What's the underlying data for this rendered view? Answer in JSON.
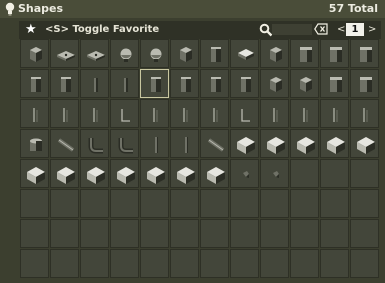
{
  "window": {
    "title": "Shapes",
    "total": "57 Total",
    "title_icon": "lightbulb-icon"
  },
  "toolbar": {
    "favorite_icon": "star-icon",
    "toggle_label": "<S> Toggle Favorite",
    "search_icon": "magnifier-icon",
    "search_value": "",
    "clear_icon": "backspace-icon",
    "page_prev": "<",
    "page_number": "1",
    "page_next": ">"
  },
  "grid": {
    "columns": 12,
    "rows": 8,
    "selected_index": 16,
    "items": [
      {
        "name": "cube-full",
        "kind": "cube"
      },
      {
        "name": "plate-studded",
        "kind": "plate"
      },
      {
        "name": "plate-flat",
        "kind": "plate"
      },
      {
        "name": "sphere-top",
        "kind": "sphere"
      },
      {
        "name": "sphere-pole",
        "kind": "sphere"
      },
      {
        "name": "cube-dark",
        "kind": "cube"
      },
      {
        "name": "pillar-small",
        "kind": "pillar"
      },
      {
        "name": "slab-light",
        "kind": "slab"
      },
      {
        "name": "cube-light",
        "kind": "cube"
      },
      {
        "name": "block-tall",
        "kind": "block"
      },
      {
        "name": "block-tall-dark",
        "kind": "block"
      },
      {
        "name": "block-side",
        "kind": "block"
      },
      {
        "name": "pillar-medium",
        "kind": "pillar"
      },
      {
        "name": "pillar-notched",
        "kind": "pillar"
      },
      {
        "name": "pillar-thin",
        "kind": "pillar-thin"
      },
      {
        "name": "pillar-thin-b",
        "kind": "pillar-thin"
      },
      {
        "name": "pillar-frame",
        "kind": "pillar"
      },
      {
        "name": "pillar-wide",
        "kind": "pillar"
      },
      {
        "name": "pillar-short",
        "kind": "pillar"
      },
      {
        "name": "pillar-stub",
        "kind": "pillar"
      },
      {
        "name": "cube-small",
        "kind": "cube"
      },
      {
        "name": "cube-small-b",
        "kind": "cube"
      },
      {
        "name": "block-bench",
        "kind": "block"
      },
      {
        "name": "block-cabinet",
        "kind": "block"
      },
      {
        "name": "pole-thin",
        "kind": "pole"
      },
      {
        "name": "pole-double",
        "kind": "pole"
      },
      {
        "name": "pole-triple",
        "kind": "pole"
      },
      {
        "name": "pole-bent",
        "kind": "pole-bent"
      },
      {
        "name": "pole-single",
        "kind": "pole"
      },
      {
        "name": "pole-short",
        "kind": "pole"
      },
      {
        "name": "pole-tiny",
        "kind": "pole"
      },
      {
        "name": "pole-corner",
        "kind": "pole-bent"
      },
      {
        "name": "pole-thin-b",
        "kind": "pole"
      },
      {
        "name": "pole-short-b",
        "kind": "pole"
      },
      {
        "name": "pole-stub",
        "kind": "pole"
      },
      {
        "name": "pole-stub-b",
        "kind": "pole"
      },
      {
        "name": "cylinder-cap",
        "kind": "cylinder"
      },
      {
        "name": "pipe-diagonal",
        "kind": "pipe"
      },
      {
        "name": "pipe-elbow",
        "kind": "pipe-elbow"
      },
      {
        "name": "pipe-bend",
        "kind": "pipe-elbow"
      },
      {
        "name": "rod-vertical",
        "kind": "rod"
      },
      {
        "name": "rod-ribbed",
        "kind": "rod"
      },
      {
        "name": "pipe-joint",
        "kind": "pipe"
      },
      {
        "name": "wedge-white",
        "kind": "wedge"
      },
      {
        "name": "wedge-white-b",
        "kind": "wedge"
      },
      {
        "name": "wedge-flat",
        "kind": "wedge"
      },
      {
        "name": "wedge-corner",
        "kind": "wedge"
      },
      {
        "name": "wedge-ramp",
        "kind": "wedge"
      },
      {
        "name": "wedge-cube",
        "kind": "wedge"
      },
      {
        "name": "wedge-slope",
        "kind": "wedge"
      },
      {
        "name": "wedge-tall",
        "kind": "wedge"
      },
      {
        "name": "wedge-flat-b",
        "kind": "wedge"
      },
      {
        "name": "wedge-thin",
        "kind": "wedge"
      },
      {
        "name": "wedge-low",
        "kind": "wedge"
      },
      {
        "name": "wedge-cap",
        "kind": "wedge"
      },
      {
        "name": "fragment-small",
        "kind": "fragment"
      },
      {
        "name": "fragment-tiny",
        "kind": "fragment"
      }
    ]
  },
  "colors": {
    "window_bg": "#3c3f2f",
    "titlebar": "#4a4d39",
    "cell_bg": "#43463a",
    "cell_border": "#2e3026",
    "selected_border": "#c9c7a0"
  }
}
